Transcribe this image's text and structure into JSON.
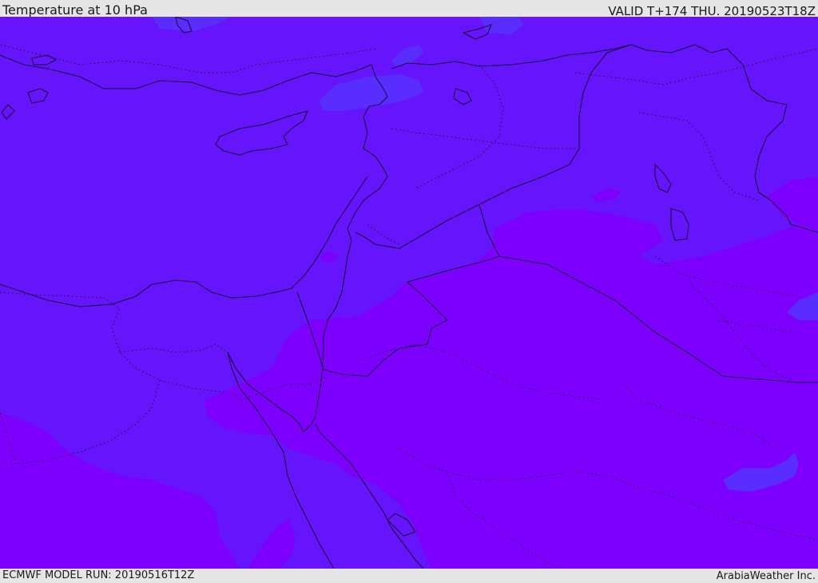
{
  "header": {
    "title": "Temperature at 10 hPa",
    "valid_time": "VALID T+174 THU. 20190523T18Z"
  },
  "footer": {
    "model_run": "ECMWF MODEL RUN: 20190516T12Z",
    "credit": "ArabiaWeather Inc."
  },
  "map": {
    "colors": {
      "band_cool": "#6514fb",
      "band_cooler": "#5a2dff",
      "band_warm": "#7d00ff",
      "coastline": "#1a0f3c",
      "border": "#2a1550"
    }
  }
}
